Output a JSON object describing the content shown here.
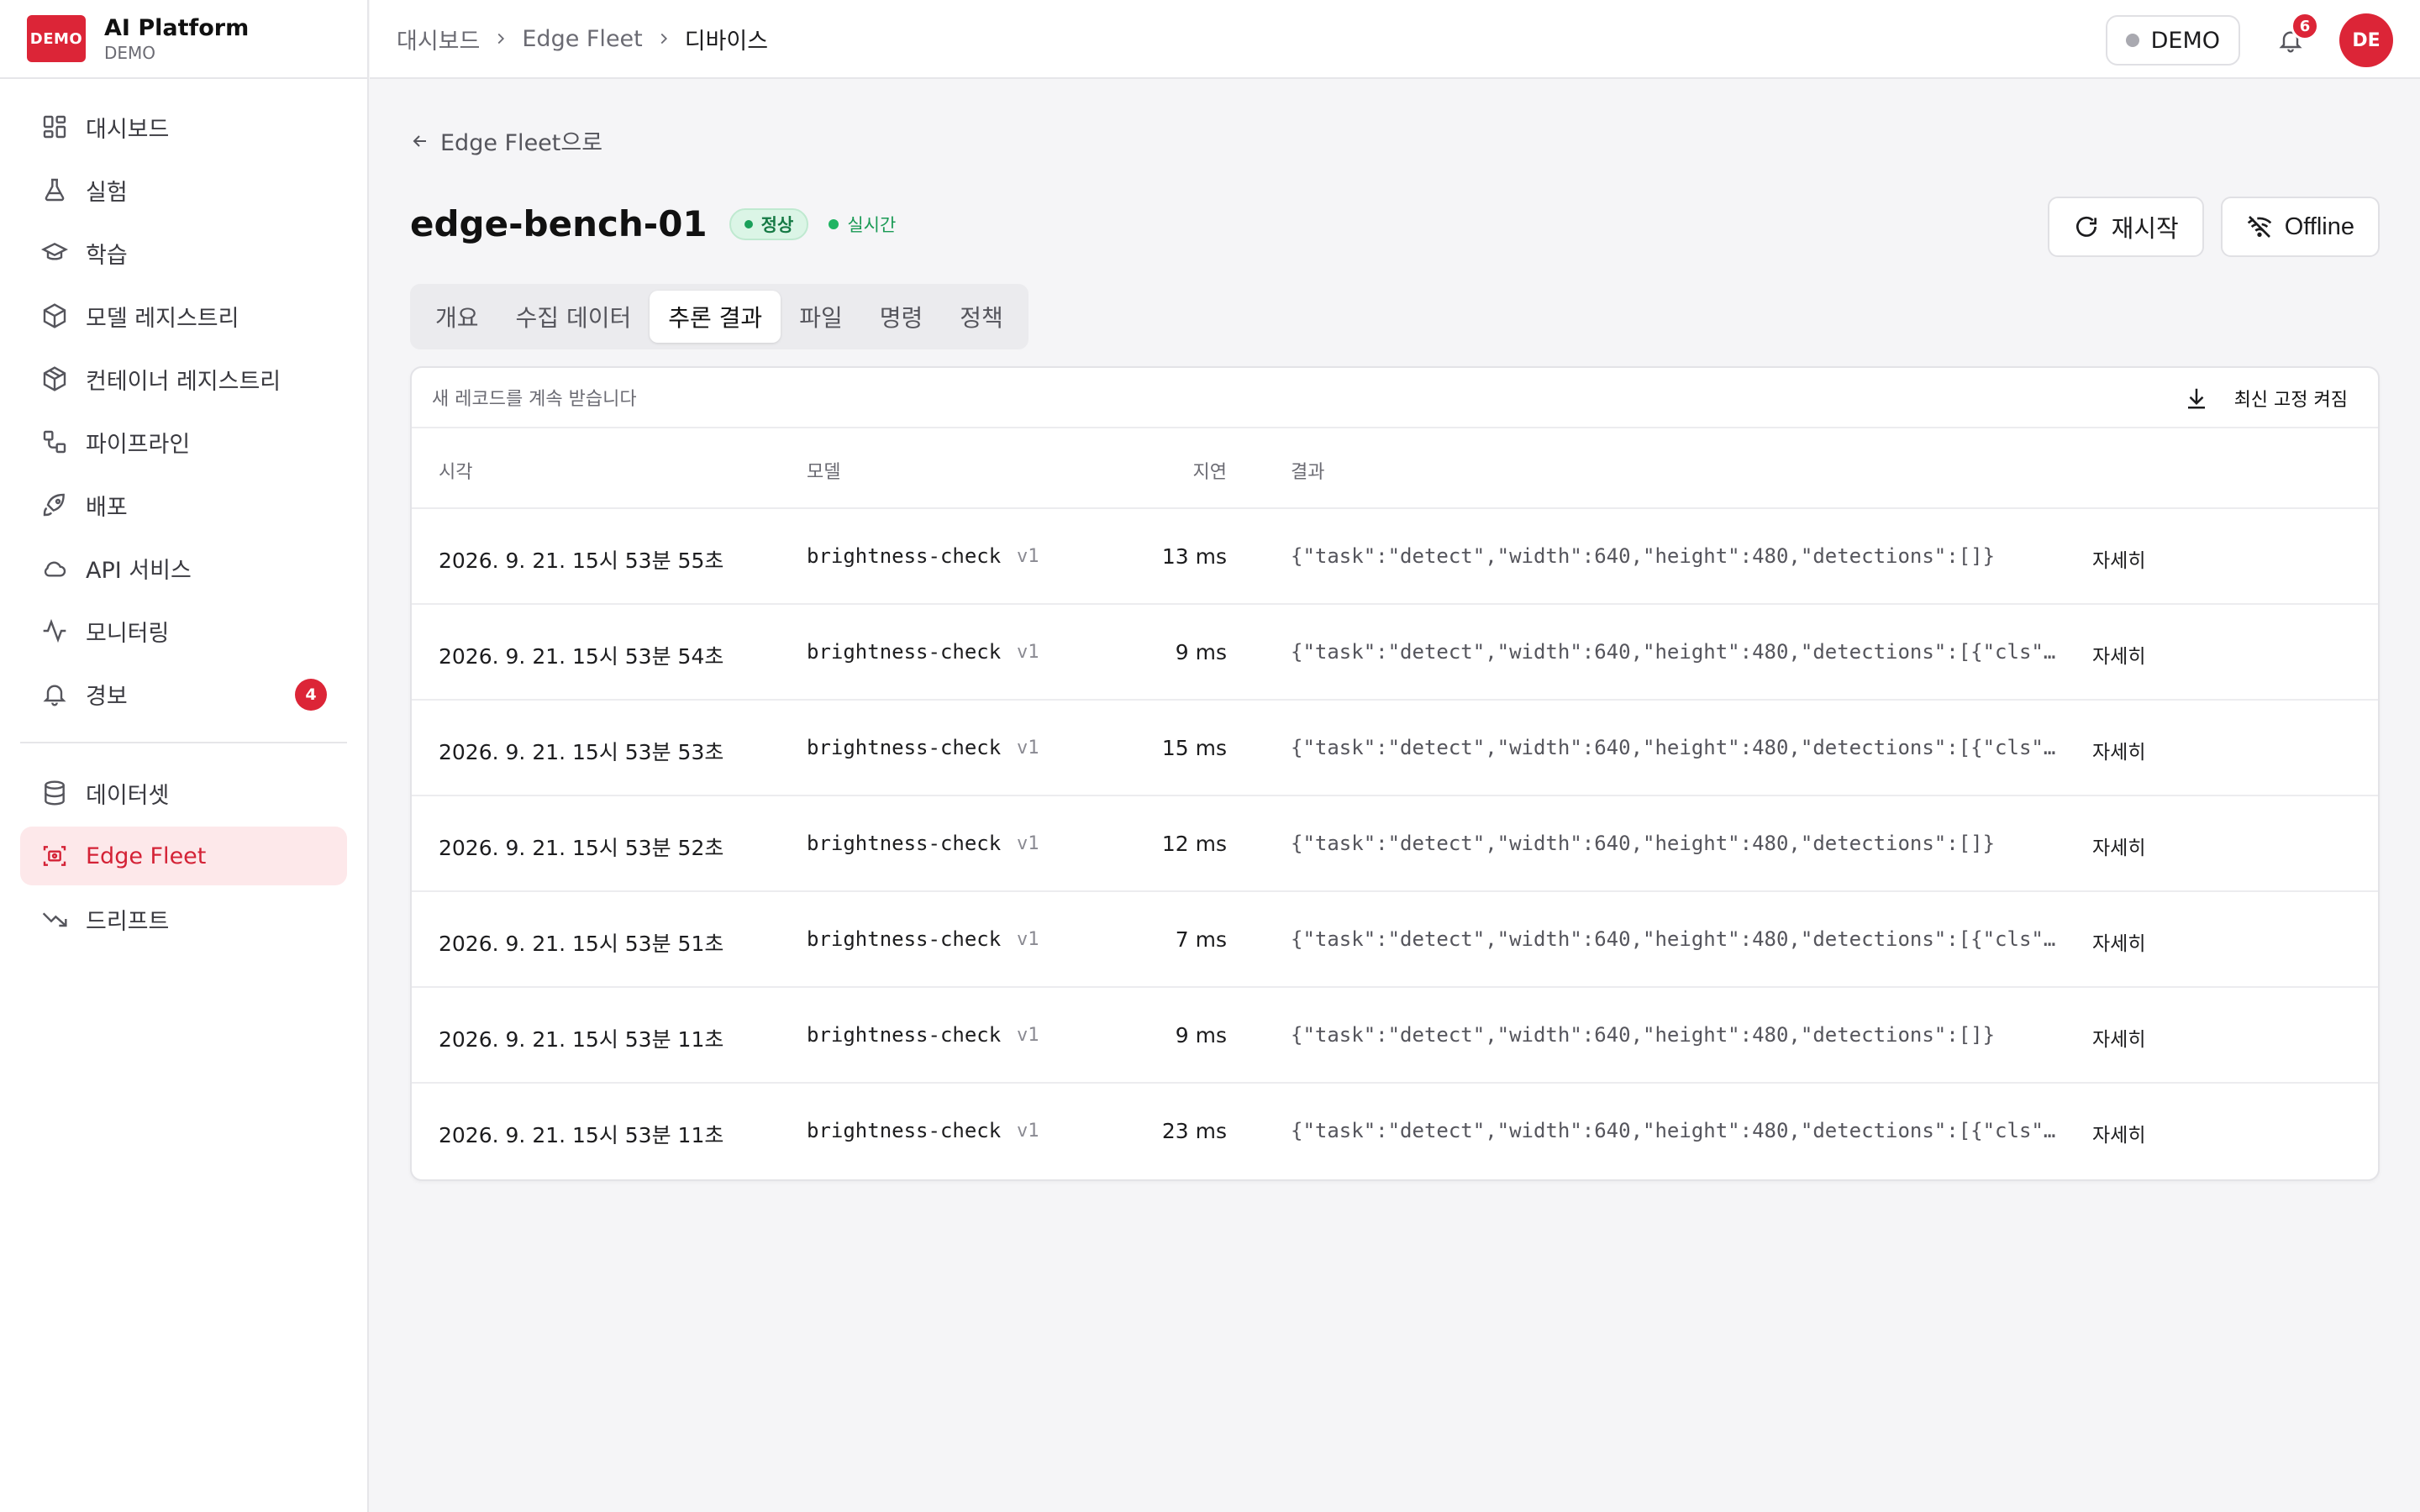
{
  "brand": {
    "logo": "DEMO",
    "name": "AI Platform",
    "sub": "DEMO"
  },
  "sidebar": {
    "items": [
      {
        "label": "대시보드",
        "icon": "dashboard-icon"
      },
      {
        "label": "실험",
        "icon": "flask-icon"
      },
      {
        "label": "학습",
        "icon": "graduation-cap-icon"
      },
      {
        "label": "모델 레지스트리",
        "icon": "cube-icon"
      },
      {
        "label": "컨테이너 레지스트리",
        "icon": "box-icon"
      },
      {
        "label": "파이프라인",
        "icon": "workflow-icon"
      },
      {
        "label": "배포",
        "icon": "rocket-icon"
      },
      {
        "label": "API 서비스",
        "icon": "cloud-icon"
      },
      {
        "label": "모니터링",
        "icon": "activity-icon"
      },
      {
        "label": "경보",
        "icon": "bell-icon",
        "badge": "4"
      }
    ],
    "items2": [
      {
        "label": "데이터셋",
        "icon": "database-icon"
      },
      {
        "label": "Edge Fleet",
        "icon": "edge-device-icon",
        "active": true
      },
      {
        "label": "드리프트",
        "icon": "trending-down-icon"
      }
    ]
  },
  "topbar": {
    "breadcrumb": [
      "대시보드",
      "Edge Fleet",
      "디바이스"
    ],
    "demo_label": "DEMO",
    "notification_count": "6",
    "avatar": "DE"
  },
  "device": {
    "back_label": "Edge Fleet으로",
    "name": "edge-bench-01",
    "status": "정상",
    "live": "실시간",
    "restart_label": "재시작",
    "offline_label": "Offline"
  },
  "tabs": [
    "개요",
    "수집 데이터",
    "추론 결과",
    "파일",
    "명령",
    "정책"
  ],
  "active_tab": "추론 결과",
  "results": {
    "note": "새 레코드를 계속 받습니다",
    "pin_label": "최신 고정 켜짐",
    "columns": {
      "time": "시각",
      "model": "모델",
      "latency": "지연",
      "result": "결과"
    },
    "detail_label": "자세히",
    "rows": [
      {
        "time": "2026. 9. 21. 15시 53분 55초",
        "model": "brightness-check",
        "version": "v1",
        "latency": "13 ms",
        "result": "{\"task\":\"detect\",\"width\":640,\"height\":480,\"detections\":[]}"
      },
      {
        "time": "2026. 9. 21. 15시 53분 54초",
        "model": "brightness-check",
        "version": "v1",
        "latency": "9 ms",
        "result": "{\"task\":\"detect\",\"width\":640,\"height\":480,\"detections\":[{\"cls\":…"
      },
      {
        "time": "2026. 9. 21. 15시 53분 53초",
        "model": "brightness-check",
        "version": "v1",
        "latency": "15 ms",
        "result": "{\"task\":\"detect\",\"width\":640,\"height\":480,\"detections\":[{\"cls\":…"
      },
      {
        "time": "2026. 9. 21. 15시 53분 52초",
        "model": "brightness-check",
        "version": "v1",
        "latency": "12 ms",
        "result": "{\"task\":\"detect\",\"width\":640,\"height\":480,\"detections\":[]}"
      },
      {
        "time": "2026. 9. 21. 15시 53분 51초",
        "model": "brightness-check",
        "version": "v1",
        "latency": "7 ms",
        "result": "{\"task\":\"detect\",\"width\":640,\"height\":480,\"detections\":[{\"cls\":…"
      },
      {
        "time": "2026. 9. 21. 15시 53분 11초",
        "model": "brightness-check",
        "version": "v1",
        "latency": "9 ms",
        "result": "{\"task\":\"detect\",\"width\":640,\"height\":480,\"detections\":[]}"
      },
      {
        "time": "2026. 9. 21. 15시 53분 11초",
        "model": "brightness-check",
        "version": "v1",
        "latency": "23 ms",
        "result": "{\"task\":\"detect\",\"width\":640,\"height\":480,\"detections\":[{\"cls\":…"
      }
    ]
  },
  "colors": {
    "accent": "#dc2537",
    "success": "#1aa05a",
    "active_bg": "#fde8ea"
  }
}
